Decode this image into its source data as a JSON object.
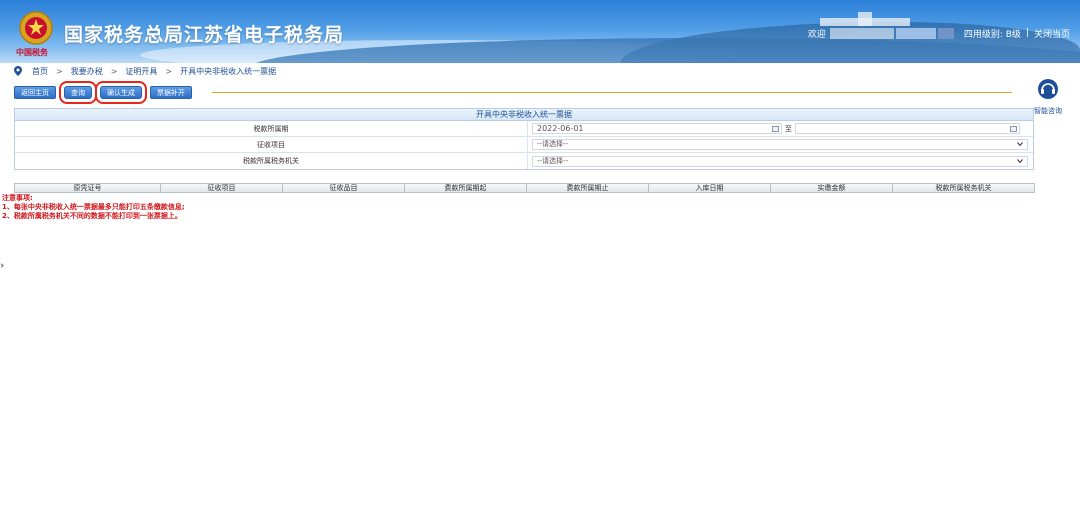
{
  "header": {
    "site_title": "国家税务总局江苏省电子税务局",
    "emblem_text": "中国税务",
    "welcome": "欢迎",
    "level_label": "四用级别: B级",
    "separator": "|",
    "close_label": "关闭当页"
  },
  "breadcrumb": {
    "items": [
      "首页",
      "我要办税",
      "证明开具",
      "开具中央非税收入统一票据"
    ],
    "arrow": ">"
  },
  "toolbar": {
    "buttons": [
      {
        "label": "返回主页",
        "highlight": false
      },
      {
        "label": "查询",
        "highlight": true
      },
      {
        "label": "确认生成",
        "highlight": true
      },
      {
        "label": "票据补开",
        "highlight": false
      }
    ]
  },
  "help": {
    "label": "智能咨询"
  },
  "form": {
    "title": "开具中央非税收入统一票据",
    "rows": [
      {
        "label": "税款所属期",
        "start_value": "2022-06-01",
        "to_label": "至",
        "end_value": ""
      },
      {
        "label": "征收项目",
        "select_value": "--请选择--"
      },
      {
        "label": "税款所属税务机关",
        "select_value": "--请选择--"
      }
    ]
  },
  "grid": {
    "columns": [
      "原凭证号",
      "征收项目",
      "征收品目",
      "费款所属期起",
      "费款所属期止",
      "入库日期",
      "实缴金额",
      "税款所属税务机关"
    ]
  },
  "notes": {
    "title": "注意事项:",
    "items": [
      "1、每张中央非税收入统一票据最多只能打印五条缴款信息;",
      "2、税款所属税务机关不同的数据不能打印到一张票据上。"
    ]
  },
  "colors": {
    "accent": "#2f6fc5",
    "highlight_border": "#e8261c",
    "note_text": "#d0161b",
    "link_text": "#1f4f96"
  }
}
